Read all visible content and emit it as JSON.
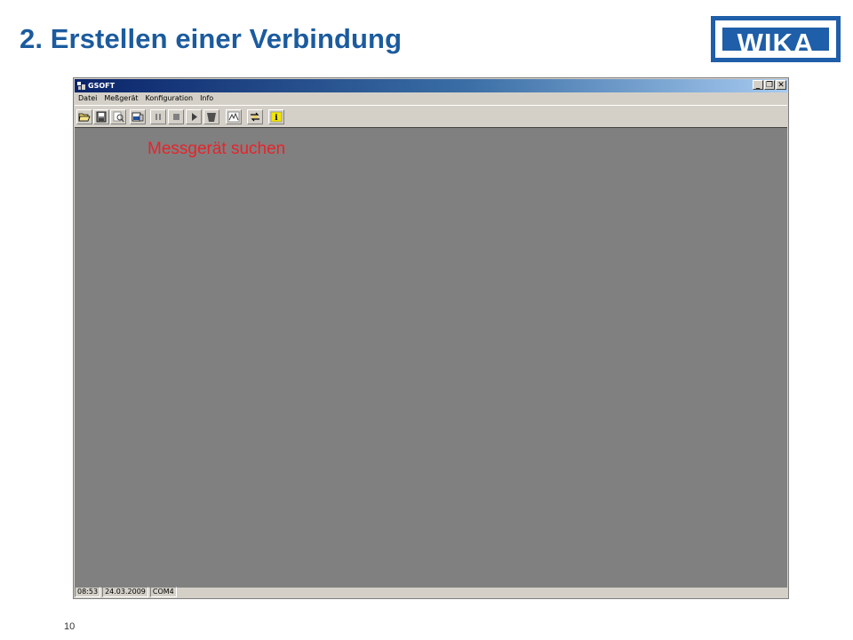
{
  "slide": {
    "title": "2. Erstellen einer Verbindung",
    "logo_text": "WIKA",
    "page_number": "10",
    "annotation": "Messgerät suchen",
    "brand_color": "#1b5b9e",
    "annotation_color": "#e8232a"
  },
  "window": {
    "title": "GSOFT",
    "buttons": {
      "minimize": "_",
      "restore": "❐",
      "close": "✕"
    },
    "menu": [
      "Datei",
      "Meßgerät",
      "Konfiguration",
      "Info"
    ],
    "toolbar": [
      {
        "name": "open-folder-icon"
      },
      {
        "name": "save-icon"
      },
      {
        "name": "print-preview-icon"
      },
      {
        "name": "search-device-icon",
        "highlighted": true
      },
      {
        "name": "pause-icon"
      },
      {
        "name": "stop-icon"
      },
      {
        "name": "play-icon"
      },
      {
        "name": "trash-icon"
      },
      {
        "name": "chart-icon"
      },
      {
        "name": "transfer-icon"
      },
      {
        "name": "info-icon"
      }
    ],
    "workspace_color": "#808080",
    "status": {
      "time": "08:53",
      "date": "24.03.2009",
      "port": "COM4"
    }
  }
}
